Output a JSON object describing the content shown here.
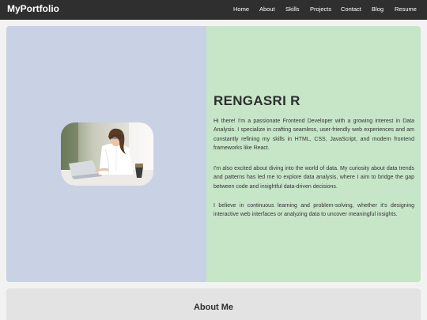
{
  "navbar": {
    "brand": "MyPortfolio",
    "links": [
      "Home",
      "About",
      "Skills",
      "Projects",
      "Contact",
      "Blog",
      "Resume"
    ]
  },
  "hero": {
    "image_alt": "professional woman working at a laptop",
    "name": "RENGASRI R",
    "paragraphs": [
      "Hi there! I'm a passionate Frontend Developer with a growing interest in Data Analysis. I specialize in crafting seamless, user-friendly web experiences and am constantly refining my skills in HTML, CSS, JavaScript, and modern frontend frameworks like React.",
      "I'm also excited about diving into the world of data. My curiosity about data trends and patterns has led me to explore data analysis, where I aim to bridge the gap between code and insightful data-driven decisions.",
      "I believe in continuous learning and problem-solving, whether it's designing interactive web interfaces or analyzing data to uncover meaningful insights."
    ]
  },
  "about": {
    "title": "About Me"
  },
  "colors": {
    "navbar_bg": "#2f2f2f",
    "hero_left_bg": "#c9d2e4",
    "hero_right_bg": "#c7e6c8",
    "about_bg": "#e3e3e3"
  }
}
